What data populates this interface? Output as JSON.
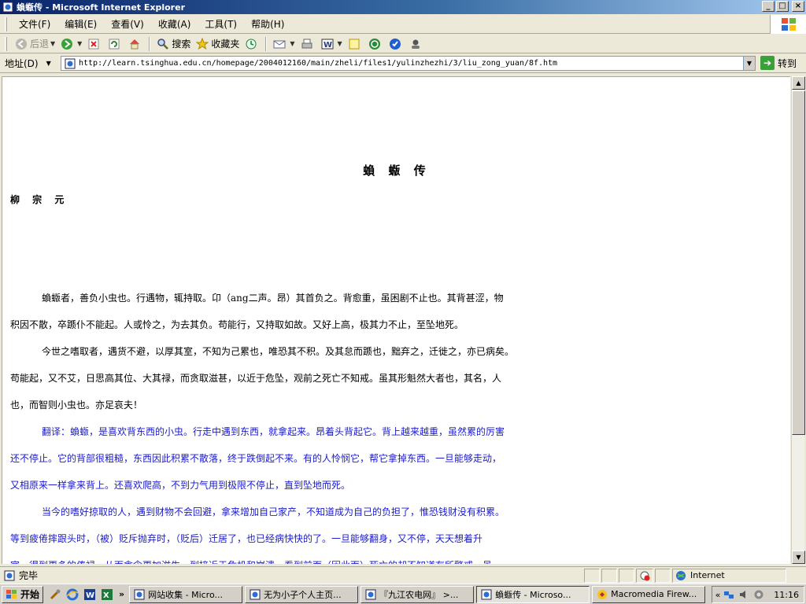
{
  "window": {
    "title": "蝜蝂传 - Microsoft Internet Explorer",
    "minimize": "_",
    "maximize": "□",
    "close": "×"
  },
  "menu": [
    "文件(F)",
    "编辑(E)",
    "查看(V)",
    "收藏(A)",
    "工具(T)",
    "帮助(H)"
  ],
  "toolbar": {
    "back": "后退",
    "search": "搜索",
    "favorites": "收藏夹"
  },
  "address": {
    "label": "地址(D)",
    "url": "http://learn.tsinghua.edu.cn/homepage/2004012160/main/zheli/files1/yulinzhezhi/3/liu_zong_yuan/8f.htm",
    "go": "转到"
  },
  "page": {
    "title": "蝜 蝂 传",
    "author": "柳 宗 元",
    "lines": [
      "蝜蝂者，善负小虫也。行遇物，辄持取。卬（ang二声。昂）其首负之。背愈重，虽困剧不止也。其背甚涩，物",
      "积因不散，卒踬仆不能起。人或怜之，为去其负。苟能行，又持取如故。又好上高，极其力不止，至坠地死。",
      "今世之嗜取者，遇货不避，以厚其室，不知为己累也，唯恐其不积。及其怠而踬也，黜弃之，迁徙之，亦已病矣。",
      "苟能起，又不艾，日思高其位、大其禄，而贪取滋甚，以近于危坠，观前之死亡不知戒。虽其形魁然大者也，其名，人",
      "也，而智则小虫也。亦足哀夫！",
      "翻译：蝜蝂，是喜欢背东西的小虫。行走中遇到东西，就拿起来。昂着头背起它。背上越来越重，虽然累的厉害",
      "还不停止。它的背部很粗糙，东西因此积累不散落，终于跌倒起不来。有的人怜悯它，帮它拿掉东西。一旦能够走动，",
      "又相原来一样拿来背上。还喜欢爬高，不到力气用到极限不停止，直到坠地而死。",
      "当今的嗜好掠取的人，遇到财物不会回避，拿来增加自己家产，不知道成为自己的负担了，惟恐钱财没有积累。",
      "等到疲倦摔跟头时，（被）贬斥抛弃时，（贬后）迁居了，也已经病快快的了。一旦能够翻身，又不停，天天想着升",
      "官、得到更多的俸禄，从而贪念更加滋生，到接近于危机和崩溃，看到前面（因此而）死亡的却不知道有所警戒。虽"
    ]
  },
  "status": {
    "text": "完毕",
    "zone": "Internet"
  },
  "taskbar": {
    "start": "开始",
    "more": "»",
    "tasks": [
      {
        "label": "网站收集 - Micro..."
      },
      {
        "label": "无为小子个人主页..."
      },
      {
        "label": "『九江农电网』 >..."
      },
      {
        "label": "蝜蝂传 - Microso..."
      },
      {
        "label": "Macromedia Firew..."
      }
    ],
    "tray_more": "«",
    "clock": "11:16"
  },
  "colors": {
    "title_start": "#0a246a",
    "translation_text": "#1a1ad0",
    "chrome": "#ece9d8"
  }
}
